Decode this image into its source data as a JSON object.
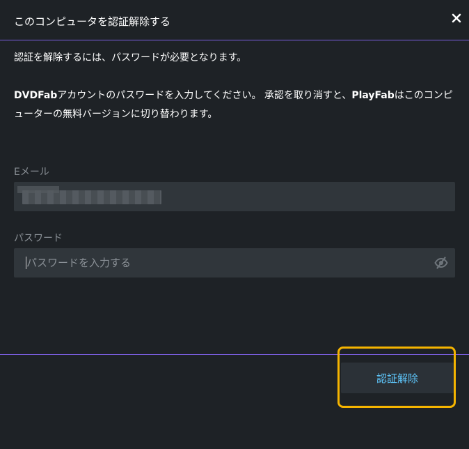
{
  "dialog": {
    "title": "このコンピュータを認証解除する",
    "close_icon": "close-icon",
    "lead": "認証を解除するには、パスワードが必要となります。",
    "description": {
      "brand_1": "DVDFab",
      "part_1": "アカウントのパスワードを入力してください。 承認を取り消すと、",
      "brand_2": "PlayFab",
      "part_2": "はこのコンピューターの無料バージョンに切り替わります。"
    },
    "email": {
      "label": "Eメール",
      "value_hidden": true
    },
    "password": {
      "label": "パスワード",
      "placeholder": "パスワードを入力する",
      "value": "",
      "toggle_icon": "eye-off-icon"
    },
    "primary_button_label": "認証解除"
  },
  "colors": {
    "background": "#1e2226",
    "field_background": "#30363b",
    "accent_line": "#7b5fe0",
    "button_text": "#5fc9ff",
    "highlight": "#f5b400",
    "muted_text": "#8a9096"
  }
}
